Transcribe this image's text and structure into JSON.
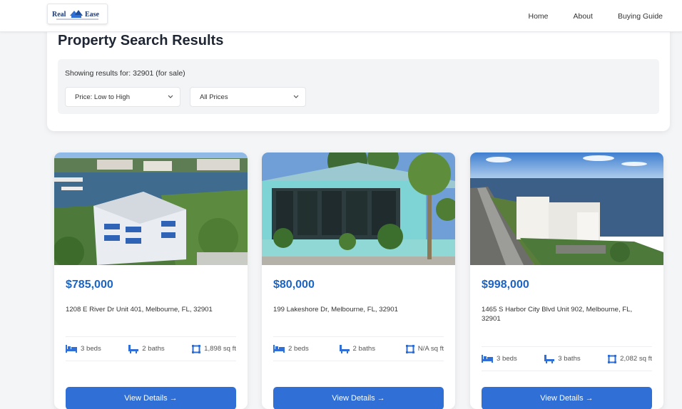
{
  "header": {
    "logo_alt": "Real Ease",
    "nav": [
      "Home",
      "About",
      "Buying Guide"
    ]
  },
  "search": {
    "title": "Property Search Results",
    "results_text": "Showing results for: 32901 (for sale)",
    "sort_select": "Price: Low to High",
    "price_select": "All Prices"
  },
  "listings": [
    {
      "price": "$785,000",
      "address": "1208 E River Dr Unit 401, Melbourne, FL, 32901",
      "beds": "3 beds",
      "baths": "2 baths",
      "sqft": "1,898 sq ft",
      "button": "View Details →"
    },
    {
      "price": "$80,000",
      "address": "199 Lakeshore Dr, Melbourne, FL, 32901",
      "beds": "2 beds",
      "baths": "2 baths",
      "sqft": "N/A sq ft",
      "button": "View Details →"
    },
    {
      "price": "$998,000",
      "address": "1465 S Harbor City Blvd Unit 902, Melbourne, FL, 32901",
      "beds": "3 beds",
      "baths": "3 baths",
      "sqft": "2,082 sq ft",
      "button": "View Details →"
    }
  ],
  "icons": [
    "house-logo-icon",
    "chevron-down-icon",
    "bed-icon",
    "bath-icon",
    "area-icon",
    "arrow-right-icon"
  ],
  "colors": {
    "accent": "#2f6fd6",
    "price": "#1c64c4",
    "icon": "#2f6fd6"
  }
}
